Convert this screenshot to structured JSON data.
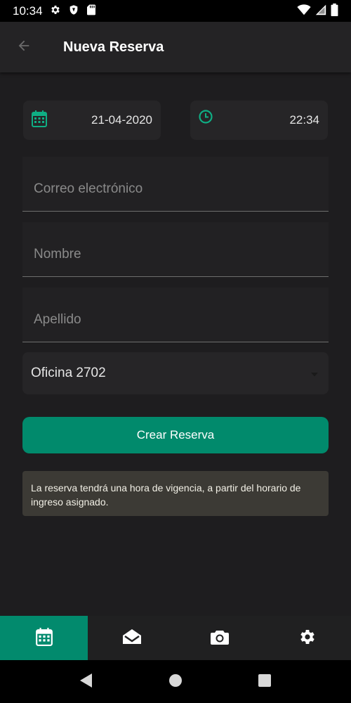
{
  "status_bar": {
    "time": "10:34",
    "left_icons": [
      "gear-icon",
      "shield-icon",
      "sd-card-icon"
    ],
    "right_icons": [
      "wifi-icon",
      "signal-icon",
      "battery-icon"
    ]
  },
  "app_bar": {
    "title": "Nueva Reserva",
    "back_icon": "arrow-left-icon"
  },
  "form": {
    "date": {
      "value": "21-04-2020",
      "icon": "calendar-icon"
    },
    "time": {
      "value": "22:34",
      "icon": "clock-icon"
    },
    "email": {
      "value": "",
      "placeholder": "Correo electrónico"
    },
    "first_name": {
      "value": "",
      "placeholder": "Nombre"
    },
    "last_name": {
      "value": "",
      "placeholder": "Apellido"
    },
    "office": {
      "selected": "Oficina 2702"
    },
    "submit_label": "Crear Reserva",
    "notice": "La reserva tendrá una hora de vigencia, a partir del horario de ingreso asignado."
  },
  "bottom_nav": {
    "items": [
      {
        "icon": "calendar-icon",
        "active": true
      },
      {
        "icon": "envelope-open-icon",
        "active": false
      },
      {
        "icon": "camera-icon",
        "active": false
      },
      {
        "icon": "gear-icon",
        "active": false
      }
    ]
  },
  "system_nav": [
    "back-triangle-icon",
    "home-circle-icon",
    "recents-square-icon"
  ],
  "colors": {
    "accent": "#018a6c",
    "icon_accent": "#0fae84",
    "background": "#1e1d1f",
    "app_bar": "#242325",
    "notice_bg": "#3c3a35"
  }
}
